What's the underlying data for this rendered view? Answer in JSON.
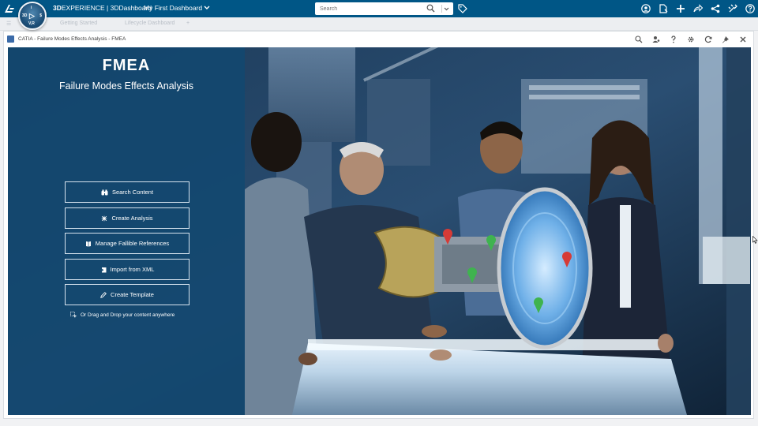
{
  "topbar": {
    "brand_bold": "3D",
    "brand_rest": "EXPERIENCE | 3DDashboard",
    "dashboard_name": "My First Dashboard",
    "search_placeholder": "Search",
    "compass_label": "V,R",
    "icons": [
      "ds-logo-icon",
      "compass-icon",
      "search-icon",
      "tag-icon",
      "user-icon",
      "notes-icon",
      "plus-icon",
      "share-icon",
      "network-icon",
      "tools-icon",
      "help-icon"
    ],
    "color": "#005686"
  },
  "tabs": [
    "Getting Started",
    "Lifecycle Dashboard"
  ],
  "widget": {
    "title": "CATIA - Failure Modes Effects Analysis - FMEA",
    "actions": [
      "search-icon",
      "user-settings-icon",
      "help-icon",
      "gear-icon",
      "refresh-icon",
      "pin-icon",
      "close-icon"
    ]
  },
  "app": {
    "title": "FMEA",
    "subtitle": "Failure Modes Effects Analysis",
    "buttons": [
      {
        "label": "Search Content",
        "icon": "binoculars-icon"
      },
      {
        "label": "Create Analysis",
        "icon": "sparkle-icon"
      },
      {
        "label": "Manage Fallible References",
        "icon": "book-icon"
      },
      {
        "label": "Import from XML",
        "icon": "import-icon"
      },
      {
        "label": "Create Template",
        "icon": "pencil-icon"
      }
    ],
    "drag_drop_text": "Or Drag and Drop your content anywhere",
    "panel_color": "#124870"
  }
}
